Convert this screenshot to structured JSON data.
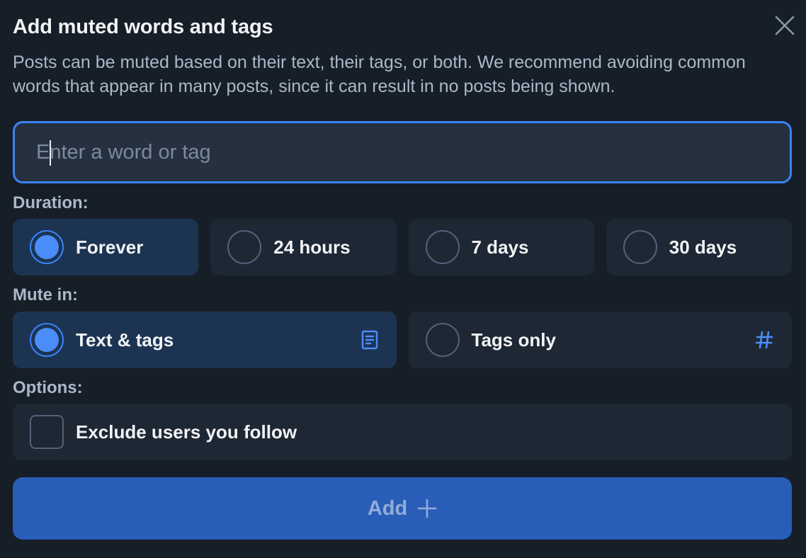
{
  "dialog": {
    "title": "Add muted words and tags",
    "description": "Posts can be muted based on their text, their tags, or both. We recommend avoiding common words that appear in many posts, since it can result in no posts being shown.",
    "close_icon": "close-icon"
  },
  "input": {
    "value": "",
    "placeholder": "Enter a word or tag"
  },
  "duration": {
    "label": "Duration:",
    "options": [
      {
        "label": "Forever",
        "selected": true
      },
      {
        "label": "24 hours",
        "selected": false
      },
      {
        "label": "7 days",
        "selected": false
      },
      {
        "label": "30 days",
        "selected": false
      }
    ]
  },
  "mute_in": {
    "label": "Mute in:",
    "options": [
      {
        "label": "Text & tags",
        "selected": true,
        "icon": "document-icon"
      },
      {
        "label": "Tags only",
        "selected": false,
        "icon": "hashtag-icon"
      }
    ]
  },
  "options": {
    "label": "Options:",
    "exclude_follows": {
      "label": "Exclude users you follow",
      "checked": false
    }
  },
  "add_button": {
    "label": "Add",
    "icon": "plus-icon"
  },
  "colors": {
    "background": "#161e27",
    "accent": "#3b82f6",
    "button": "#295db8"
  }
}
